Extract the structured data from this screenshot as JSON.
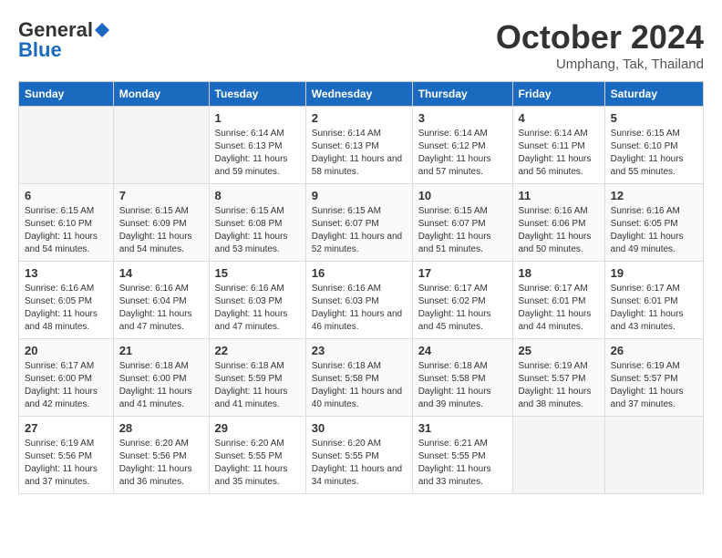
{
  "logo": {
    "general": "General",
    "blue": "Blue"
  },
  "header": {
    "month": "October 2024",
    "location": "Umphang, Tak, Thailand"
  },
  "days_of_week": [
    "Sunday",
    "Monday",
    "Tuesday",
    "Wednesday",
    "Thursday",
    "Friday",
    "Saturday"
  ],
  "weeks": [
    [
      {
        "day": "",
        "sunrise": "",
        "sunset": "",
        "daylight": ""
      },
      {
        "day": "",
        "sunrise": "",
        "sunset": "",
        "daylight": ""
      },
      {
        "day": "1",
        "sunrise": "Sunrise: 6:14 AM",
        "sunset": "Sunset: 6:13 PM",
        "daylight": "Daylight: 11 hours and 59 minutes."
      },
      {
        "day": "2",
        "sunrise": "Sunrise: 6:14 AM",
        "sunset": "Sunset: 6:13 PM",
        "daylight": "Daylight: 11 hours and 58 minutes."
      },
      {
        "day": "3",
        "sunrise": "Sunrise: 6:14 AM",
        "sunset": "Sunset: 6:12 PM",
        "daylight": "Daylight: 11 hours and 57 minutes."
      },
      {
        "day": "4",
        "sunrise": "Sunrise: 6:14 AM",
        "sunset": "Sunset: 6:11 PM",
        "daylight": "Daylight: 11 hours and 56 minutes."
      },
      {
        "day": "5",
        "sunrise": "Sunrise: 6:15 AM",
        "sunset": "Sunset: 6:10 PM",
        "daylight": "Daylight: 11 hours and 55 minutes."
      }
    ],
    [
      {
        "day": "6",
        "sunrise": "Sunrise: 6:15 AM",
        "sunset": "Sunset: 6:10 PM",
        "daylight": "Daylight: 11 hours and 54 minutes."
      },
      {
        "day": "7",
        "sunrise": "Sunrise: 6:15 AM",
        "sunset": "Sunset: 6:09 PM",
        "daylight": "Daylight: 11 hours and 54 minutes."
      },
      {
        "day": "8",
        "sunrise": "Sunrise: 6:15 AM",
        "sunset": "Sunset: 6:08 PM",
        "daylight": "Daylight: 11 hours and 53 minutes."
      },
      {
        "day": "9",
        "sunrise": "Sunrise: 6:15 AM",
        "sunset": "Sunset: 6:07 PM",
        "daylight": "Daylight: 11 hours and 52 minutes."
      },
      {
        "day": "10",
        "sunrise": "Sunrise: 6:15 AM",
        "sunset": "Sunset: 6:07 PM",
        "daylight": "Daylight: 11 hours and 51 minutes."
      },
      {
        "day": "11",
        "sunrise": "Sunrise: 6:16 AM",
        "sunset": "Sunset: 6:06 PM",
        "daylight": "Daylight: 11 hours and 50 minutes."
      },
      {
        "day": "12",
        "sunrise": "Sunrise: 6:16 AM",
        "sunset": "Sunset: 6:05 PM",
        "daylight": "Daylight: 11 hours and 49 minutes."
      }
    ],
    [
      {
        "day": "13",
        "sunrise": "Sunrise: 6:16 AM",
        "sunset": "Sunset: 6:05 PM",
        "daylight": "Daylight: 11 hours and 48 minutes."
      },
      {
        "day": "14",
        "sunrise": "Sunrise: 6:16 AM",
        "sunset": "Sunset: 6:04 PM",
        "daylight": "Daylight: 11 hours and 47 minutes."
      },
      {
        "day": "15",
        "sunrise": "Sunrise: 6:16 AM",
        "sunset": "Sunset: 6:03 PM",
        "daylight": "Daylight: 11 hours and 47 minutes."
      },
      {
        "day": "16",
        "sunrise": "Sunrise: 6:16 AM",
        "sunset": "Sunset: 6:03 PM",
        "daylight": "Daylight: 11 hours and 46 minutes."
      },
      {
        "day": "17",
        "sunrise": "Sunrise: 6:17 AM",
        "sunset": "Sunset: 6:02 PM",
        "daylight": "Daylight: 11 hours and 45 minutes."
      },
      {
        "day": "18",
        "sunrise": "Sunrise: 6:17 AM",
        "sunset": "Sunset: 6:01 PM",
        "daylight": "Daylight: 11 hours and 44 minutes."
      },
      {
        "day": "19",
        "sunrise": "Sunrise: 6:17 AM",
        "sunset": "Sunset: 6:01 PM",
        "daylight": "Daylight: 11 hours and 43 minutes."
      }
    ],
    [
      {
        "day": "20",
        "sunrise": "Sunrise: 6:17 AM",
        "sunset": "Sunset: 6:00 PM",
        "daylight": "Daylight: 11 hours and 42 minutes."
      },
      {
        "day": "21",
        "sunrise": "Sunrise: 6:18 AM",
        "sunset": "Sunset: 6:00 PM",
        "daylight": "Daylight: 11 hours and 41 minutes."
      },
      {
        "day": "22",
        "sunrise": "Sunrise: 6:18 AM",
        "sunset": "Sunset: 5:59 PM",
        "daylight": "Daylight: 11 hours and 41 minutes."
      },
      {
        "day": "23",
        "sunrise": "Sunrise: 6:18 AM",
        "sunset": "Sunset: 5:58 PM",
        "daylight": "Daylight: 11 hours and 40 minutes."
      },
      {
        "day": "24",
        "sunrise": "Sunrise: 6:18 AM",
        "sunset": "Sunset: 5:58 PM",
        "daylight": "Daylight: 11 hours and 39 minutes."
      },
      {
        "day": "25",
        "sunrise": "Sunrise: 6:19 AM",
        "sunset": "Sunset: 5:57 PM",
        "daylight": "Daylight: 11 hours and 38 minutes."
      },
      {
        "day": "26",
        "sunrise": "Sunrise: 6:19 AM",
        "sunset": "Sunset: 5:57 PM",
        "daylight": "Daylight: 11 hours and 37 minutes."
      }
    ],
    [
      {
        "day": "27",
        "sunrise": "Sunrise: 6:19 AM",
        "sunset": "Sunset: 5:56 PM",
        "daylight": "Daylight: 11 hours and 37 minutes."
      },
      {
        "day": "28",
        "sunrise": "Sunrise: 6:20 AM",
        "sunset": "Sunset: 5:56 PM",
        "daylight": "Daylight: 11 hours and 36 minutes."
      },
      {
        "day": "29",
        "sunrise": "Sunrise: 6:20 AM",
        "sunset": "Sunset: 5:55 PM",
        "daylight": "Daylight: 11 hours and 35 minutes."
      },
      {
        "day": "30",
        "sunrise": "Sunrise: 6:20 AM",
        "sunset": "Sunset: 5:55 PM",
        "daylight": "Daylight: 11 hours and 34 minutes."
      },
      {
        "day": "31",
        "sunrise": "Sunrise: 6:21 AM",
        "sunset": "Sunset: 5:55 PM",
        "daylight": "Daylight: 11 hours and 33 minutes."
      },
      {
        "day": "",
        "sunrise": "",
        "sunset": "",
        "daylight": ""
      },
      {
        "day": "",
        "sunrise": "",
        "sunset": "",
        "daylight": ""
      }
    ]
  ]
}
